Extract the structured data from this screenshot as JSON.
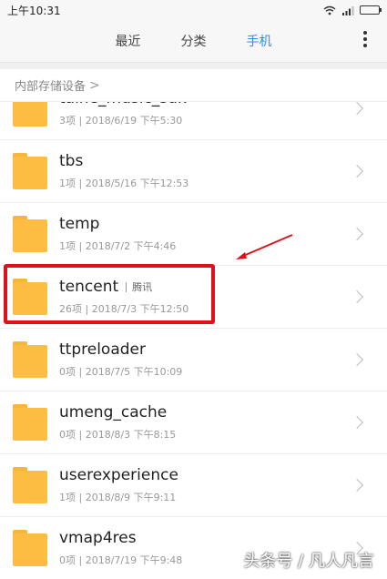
{
  "status": {
    "time": "上午10:31"
  },
  "tabs": [
    {
      "label": "最近",
      "active": false
    },
    {
      "label": "分类",
      "active": false
    },
    {
      "label": "手机",
      "active": true
    }
  ],
  "breadcrumb": {
    "path": "内部存储设备",
    "chevron": ">"
  },
  "files": [
    {
      "name": "taihe_music_sdk",
      "tag": "",
      "meta": "3项 | 2018/6/19 下午5:30"
    },
    {
      "name": "tbs",
      "tag": "",
      "meta": "1项 | 2018/5/16 下午12:53"
    },
    {
      "name": "temp",
      "tag": "",
      "meta": "1项 | 2018/7/2 下午4:46"
    },
    {
      "name": "tencent",
      "tag": "腾讯",
      "meta": "26项 | 2018/7/3 下午12:50"
    },
    {
      "name": "ttpreloader",
      "tag": "",
      "meta": "0项 | 2018/7/5 下午10:09"
    },
    {
      "name": "umeng_cache",
      "tag": "",
      "meta": "0项 | 2018/8/3 下午8:15"
    },
    {
      "name": "userexperience",
      "tag": "",
      "meta": "1项 | 2018/8/9 下午9:11"
    },
    {
      "name": "vmap4res",
      "tag": "",
      "meta": "0项 | 2018/7/19 下午9:48"
    }
  ],
  "watermark": "头条号 / 凡人凡言",
  "colors": {
    "accent": "#2c8ff2",
    "folder": "#fdbd42",
    "highlight": "#e0101a"
  }
}
